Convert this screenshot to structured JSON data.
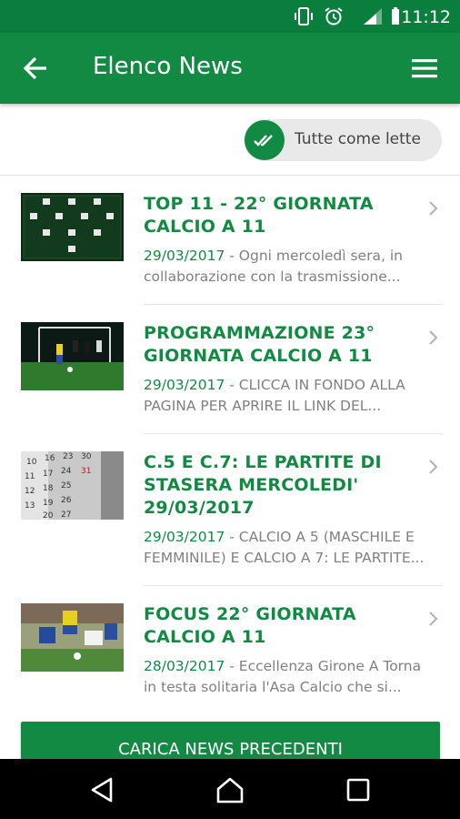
{
  "status_bar": {
    "time": "11:12",
    "icons": [
      "vibrate-icon",
      "alarm-icon",
      "signal-icon",
      "battery-icon"
    ]
  },
  "app_bar": {
    "title": "Elenco News",
    "back_icon": "arrow-back-icon",
    "menu_icon": "hamburger-menu-icon"
  },
  "toggle": {
    "label": "Tutte come lette",
    "icon": "double-check-icon"
  },
  "news": [
    {
      "title": "TOP 11 - 22° GIORNATA CALCIO A 11",
      "date": "29/03/2017",
      "separator": " - ",
      "excerpt": "Ogni mercoledì sera, in collaborazione con la trasmissione...",
      "thumb": "team-lineup-thumbnail"
    },
    {
      "title": "PROGRAMMAZIONE 23° GIORNATA CALCIO A 11",
      "date": "29/03/2017",
      "separator": " - ",
      "excerpt": "CLICCA IN FONDO ALLA PAGINA PER APRIRE IL LINK DEL...",
      "thumb": "football-match-thumbnail"
    },
    {
      "title": "C.5 E C.7: LE PARTITE DI STASERA MERCOLEDI' 29/03/2017",
      "date": "29/03/2017",
      "separator": " - ",
      "excerpt": "CALCIO A 5 (MASCHILE E FEMMINILE) E CALCIO A 7: LE PARTITE...",
      "thumb": "calendar-thumbnail"
    },
    {
      "title": "FOCUS 22° GIORNATA CALCIO A 11",
      "date": "28/03/2017",
      "separator": " - ",
      "excerpt": "Eccellenza Girone A Torna in testa solitaria l'Asa Calcio che si...",
      "thumb": "players-tackle-thumbnail"
    }
  ],
  "load_more": {
    "label": "CARICA NEWS PRECEDENTI"
  },
  "nav_bar": {
    "icons": [
      "nav-back-icon",
      "nav-home-icon",
      "nav-recents-icon"
    ]
  },
  "colors": {
    "status_bar": "#0a7f3d",
    "primary": "#138a44",
    "meta_text": "#808080",
    "toggle_bg": "#e9e9e9"
  }
}
